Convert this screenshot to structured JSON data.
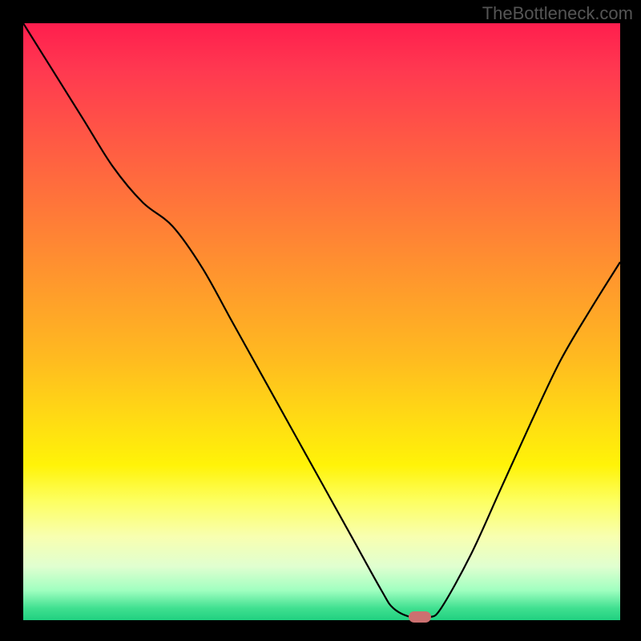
{
  "watermark": "TheBottleneck.com",
  "chart_data": {
    "type": "line",
    "title": "",
    "xlabel": "",
    "ylabel": "",
    "xlim": [
      0,
      100
    ],
    "ylim": [
      0,
      100
    ],
    "x": [
      0,
      5,
      10,
      15,
      20,
      25,
      30,
      35,
      40,
      45,
      50,
      55,
      60,
      62,
      65,
      68,
      70,
      75,
      80,
      85,
      90,
      95,
      100
    ],
    "y": [
      100,
      92,
      84,
      76,
      70,
      66,
      59,
      50,
      41,
      32,
      23,
      14,
      5,
      2,
      0.5,
      0.5,
      2,
      11,
      22,
      33,
      43.5,
      52,
      60
    ],
    "marker": {
      "x": 66.5,
      "y": 0.5
    },
    "gradient_stops": [
      {
        "pos": 0,
        "color": "#ff1e4e"
      },
      {
        "pos": 100,
        "color": "#20d080"
      }
    ]
  }
}
